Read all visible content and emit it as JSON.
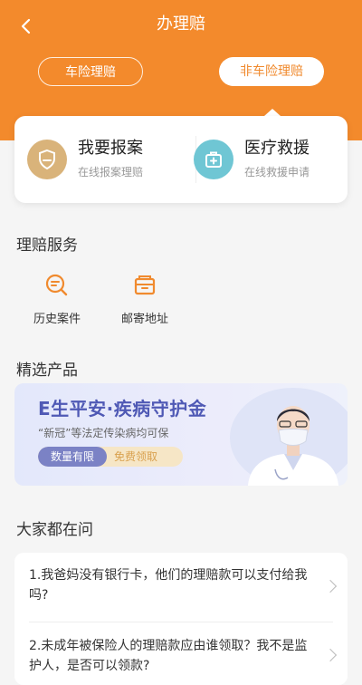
{
  "header": {
    "title": "办理赔",
    "back_icon": "chevron-left-icon",
    "background": "#f38a2c"
  },
  "tabs": [
    {
      "label": "车险理赔",
      "selected": false
    },
    {
      "label": "非车险理赔",
      "selected": true
    }
  ],
  "actions": [
    {
      "title": "我要报案",
      "subtitle": "在线报案理赔",
      "icon": "shield-icon"
    },
    {
      "title": "医疗救援",
      "subtitle": "在线救援申请",
      "icon": "medical-kit-icon"
    }
  ],
  "claim_services": {
    "title": "理赔服务",
    "items": [
      {
        "label": "历史案件",
        "icon": "search-history-icon"
      },
      {
        "label": "邮寄地址",
        "icon": "mailbox-icon"
      }
    ]
  },
  "featured": {
    "title": "精选产品",
    "banner": {
      "title": "E生平安·疾病守护金",
      "subtitle": "“新冠”等法定传染病均可保",
      "badge_left": "数量有限",
      "badge_right": "免费领取"
    }
  },
  "faq": {
    "title": "大家都在问",
    "items": [
      {
        "text": "1.我爸妈没有银行卡，他们的理赔款可以支付给我吗?"
      },
      {
        "text": "2.未成年被保险人的理赔款应由谁领取？我不是监护人，是否可以领款?"
      }
    ]
  }
}
